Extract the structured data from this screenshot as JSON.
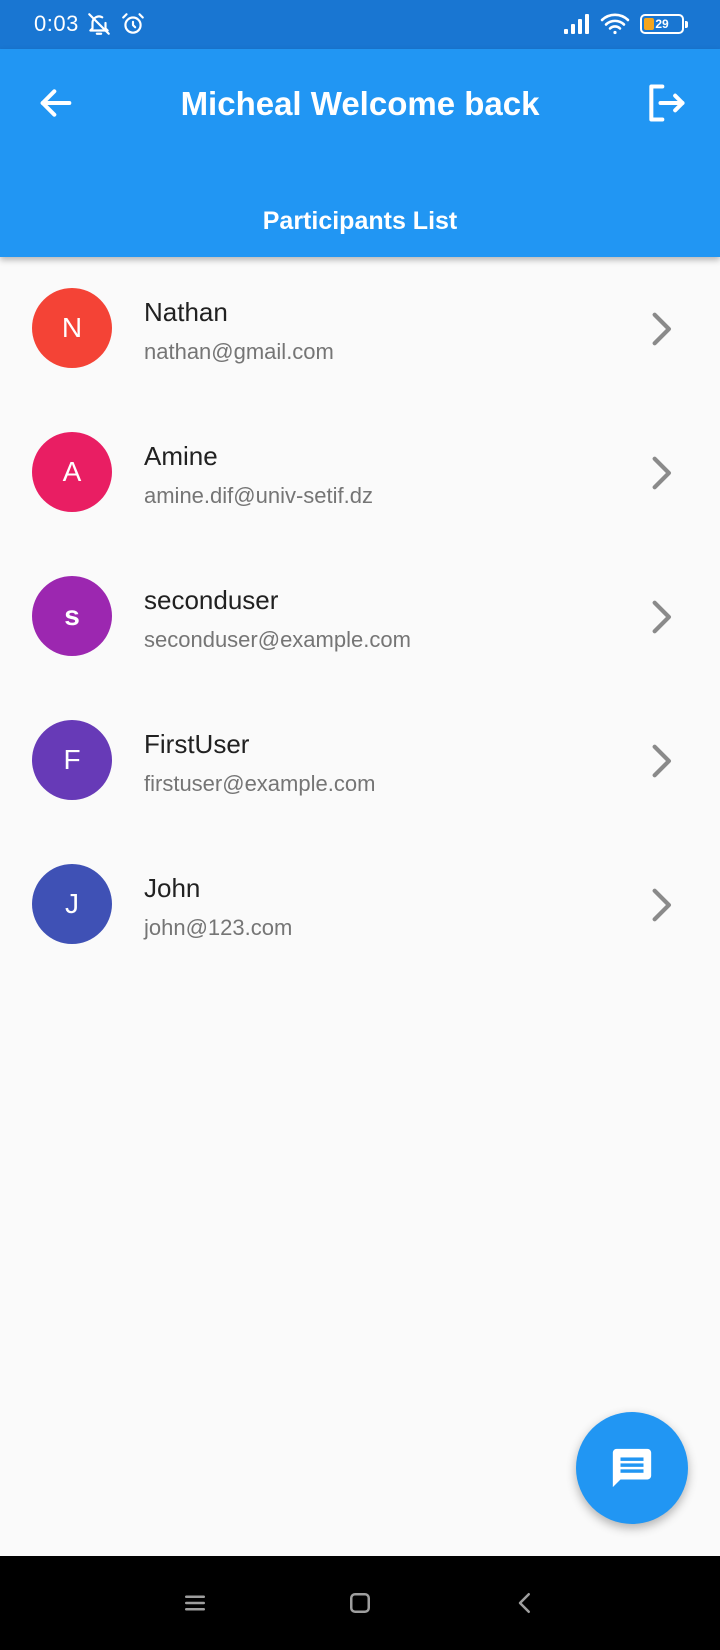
{
  "status_bar": {
    "time": "0:03",
    "battery_level": "29",
    "battery_fraction": 0.29,
    "icons": [
      "bell-off-icon",
      "alarm-icon",
      "signal-icon",
      "wifi-icon",
      "battery-icon"
    ]
  },
  "app_bar": {
    "title": "Micheal Welcome back",
    "subtitle": "Participants List",
    "back_icon": "arrow-back-icon",
    "logout_icon": "logout-icon",
    "color": "#2196f3"
  },
  "participants": [
    {
      "initial": "N",
      "name": "Nathan",
      "email": "nathan@gmail.com",
      "color": "#f44336"
    },
    {
      "initial": "A",
      "name": "Amine",
      "email": "amine.dif@univ-setif.dz",
      "color": "#e91e63"
    },
    {
      "initial": "s",
      "name": "seconduser",
      "email": "seconduser@example.com",
      "color": "#9c27b0"
    },
    {
      "initial": "F",
      "name": "FirstUser",
      "email": "firstuser@example.com",
      "color": "#673ab7"
    },
    {
      "initial": "J",
      "name": "John",
      "email": "john@123.com",
      "color": "#3f51b5"
    }
  ],
  "fab": {
    "icon": "chat-icon",
    "color": "#2196f3"
  },
  "nav_bar": {
    "icons": [
      "menu-icon",
      "home-icon",
      "back-icon"
    ]
  }
}
